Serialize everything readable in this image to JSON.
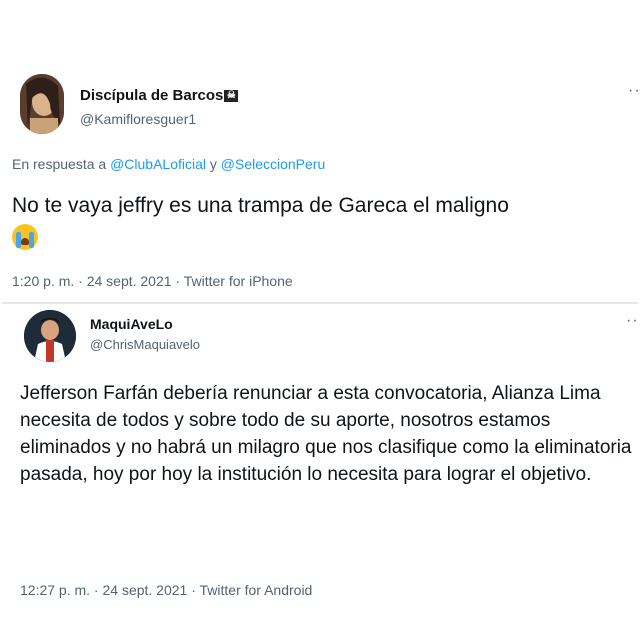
{
  "tweet1": {
    "author_name": "Discípula de Barcos",
    "handle": "@Kamifloresguer1",
    "reply_prefix": "En respuesta a",
    "mention1": "@ClubALoficial",
    "reply_join": "y",
    "mention2": "@SeleccionPeru",
    "text": "No te vaya jeffry es una trampa de Gareca el maligno",
    "meta": "1:20 p. m. · 24 sept. 2021 · Twitter for iPhone",
    "more": "···"
  },
  "tweet2": {
    "author_name": "MaquiAveLo",
    "handle": "@ChrisMaquiavelo",
    "text": "Jefferson Farfán debería renunciar a esta convocatoria, Alianza Lima necesita de todos y sobre todo de su aporte, nosotros estamos eliminados y no habrá un milagro que nos clasifique como la eliminatoria pasada, hoy por hoy la institución lo necesita para lograr el objetivo.",
    "meta": "12:27 p. m. · 24 sept. 2021 · Twitter for Android",
    "more": "···"
  },
  "icons": {
    "name_badge": "skull-crossbones-icon",
    "reaction_emoji": "loudly-crying-face-icon"
  },
  "colors": {
    "link": "#1d9bf0",
    "secondary": "#536471",
    "text": "#0f1419"
  }
}
